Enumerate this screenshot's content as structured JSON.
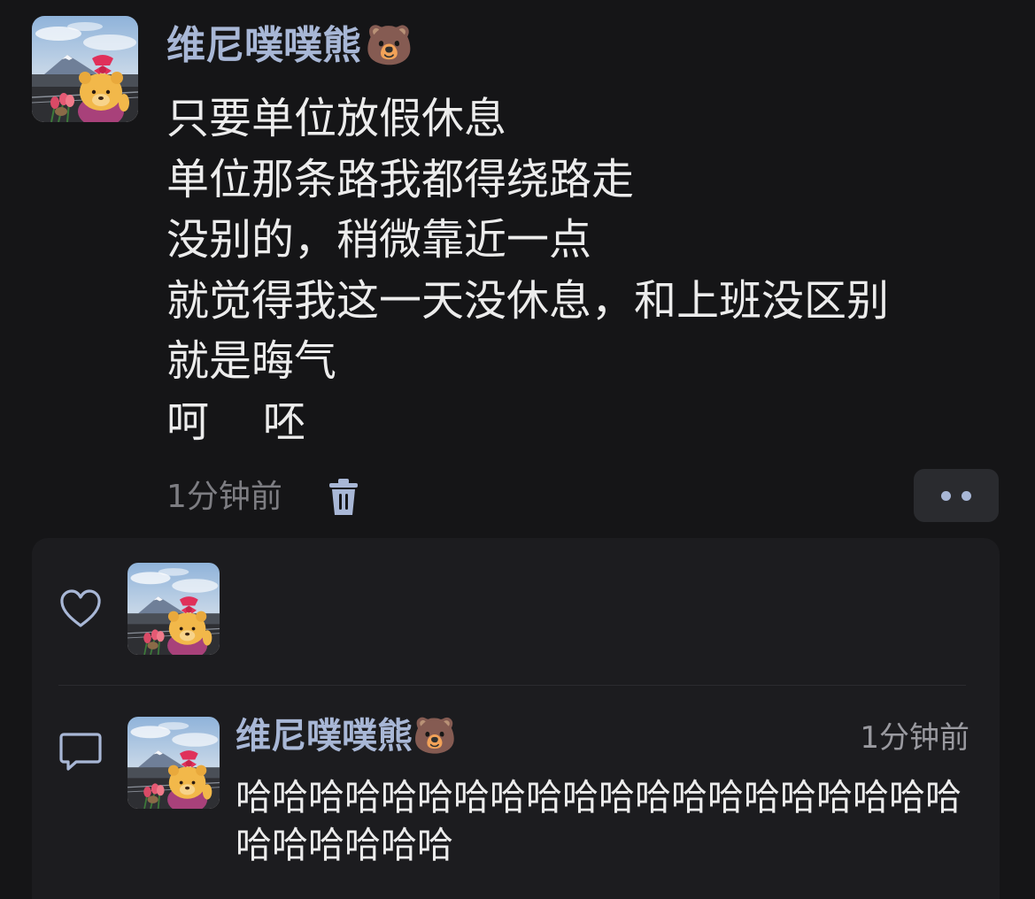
{
  "post": {
    "author": "维尼噗噗熊",
    "author_emoji": "🐻",
    "lines": [
      "只要单位放假休息",
      "单位那条路我都得绕路走",
      "没别的，稍微靠近一点",
      "就觉得我这一天没休息，和上班没区别",
      "就是晦气",
      "呵    呸"
    ],
    "time": "1分钟前",
    "delete_icon": "trash-icon",
    "more_icon": "more-dots-icon"
  },
  "likes": {
    "icon": "heart-icon"
  },
  "comments": {
    "icon": "comment-icon",
    "items": [
      {
        "author": "维尼噗噗熊",
        "author_emoji": "🐻",
        "time": "1分钟前",
        "text": "哈哈哈哈哈哈哈哈哈哈哈哈哈哈哈哈哈哈哈哈哈哈哈哈哈哈"
      }
    ]
  },
  "colors": {
    "background": "#151517",
    "panel": "#1c1c1f",
    "name": "#a8b7d6",
    "text": "#ececec",
    "muted": "#7d7d82"
  }
}
